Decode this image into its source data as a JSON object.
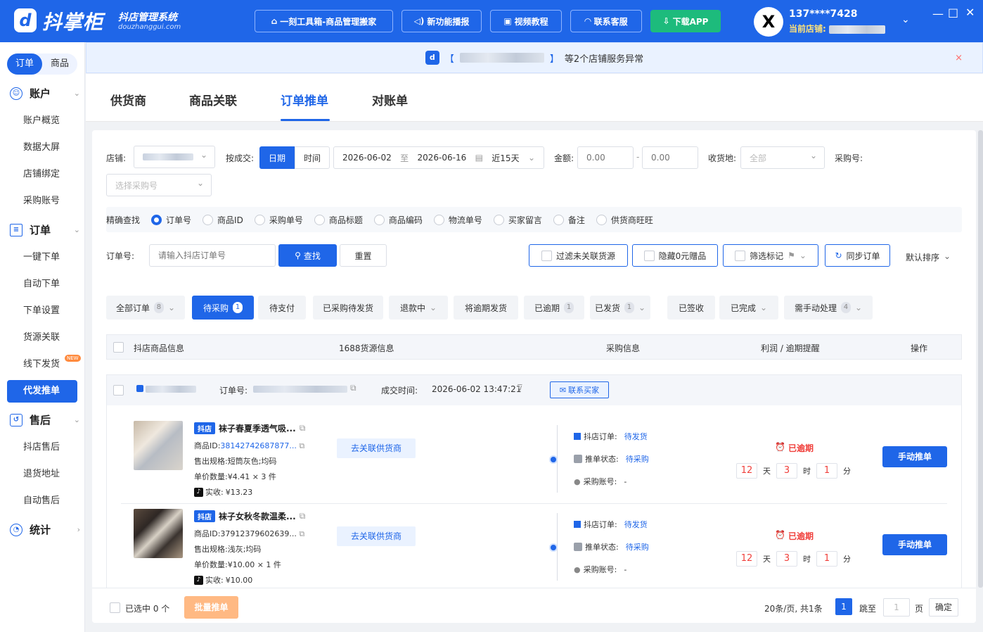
{
  "header": {
    "logo_text": "抖掌柜",
    "logo_subtitle": "抖店管理系统",
    "logo_domain": "douzhanggui.com",
    "buttons": [
      {
        "label": "一刻工具箱-商品管理搬家",
        "icon": "toolbox-icon"
      },
      {
        "label": "新功能播报",
        "icon": "speaker-icon"
      },
      {
        "label": "视频教程",
        "icon": "video-icon"
      },
      {
        "label": "联系客服",
        "icon": "headset-icon"
      },
      {
        "label": "下载APP",
        "icon": "download-icon"
      }
    ],
    "avatar_letter": "X",
    "user_phone": "137****7428",
    "current_store_label": "当前店铺:"
  },
  "sidebar": {
    "segments": [
      "订单",
      "商品"
    ],
    "groups": [
      {
        "label": "账户",
        "items": [
          "账户概览",
          "数据大屏",
          "店铺绑定",
          "采购账号"
        ]
      },
      {
        "label": "订单",
        "items": [
          "一键下单",
          "自动下单",
          "下单设置",
          "货源关联",
          "线下发货",
          "代发推单"
        ]
      },
      {
        "label": "售后",
        "items": [
          "抖店售后",
          "退货地址",
          "自动售后"
        ]
      },
      {
        "label": "统计",
        "items": []
      }
    ],
    "new_badge": "NEW"
  },
  "notice": {
    "open_bracket": "【",
    "close_bracket": "】",
    "text": "等2个店铺服务异常",
    "close": "×"
  },
  "tabs": [
    "供货商",
    "商品关联",
    "订单推单",
    "对账单"
  ],
  "filters": {
    "store_label": "店铺:",
    "deal_label": "按成交:",
    "date_btn": "日期",
    "time_btn": "时间",
    "date_start": "2026-06-02",
    "date_to": "至",
    "date_end": "2026-06-16",
    "date_range": "近15天",
    "amount_label": "金额:",
    "amount_min_placeholder": "0.00",
    "amount_sep": "-",
    "amount_max_placeholder": "0.00",
    "ship_label": "收货地:",
    "ship_value": "全部",
    "purchase_no_label": "采购号:",
    "purchase_no_placeholder": "选择采购号",
    "exact_label": "精确查找",
    "exact_options": [
      "订单号",
      "商品ID",
      "采购单号",
      "商品标题",
      "商品编码",
      "物流单号",
      "买家留言",
      "备注",
      "供货商旺旺"
    ],
    "order_no_label": "订单号:",
    "order_no_placeholder": "请输入抖店订单号",
    "search_btn": "查找",
    "reset_btn": "重置",
    "filter_unlinked": "过滤未关联货源",
    "hide_gift": "隐藏0元赠品",
    "filter_mark": "筛选标记",
    "sync_btn": "同步订单",
    "sort": "默认排序"
  },
  "status_tabs": [
    {
      "label": "全部订单",
      "count": "8",
      "chev": true
    },
    {
      "label": "待采购",
      "count": "1",
      "chev": false
    },
    {
      "label": "待支付",
      "count": "",
      "chev": false
    },
    {
      "label": "已采购待发货",
      "count": "",
      "chev": false
    },
    {
      "label": "退款中",
      "count": "",
      "chev": true
    },
    {
      "label": "将逾期发货",
      "count": "",
      "chev": false
    },
    {
      "label": "已逾期",
      "count": "1",
      "chev": false
    },
    {
      "label": "已发货",
      "count": "1",
      "chev": true
    },
    {
      "label": "已签收",
      "count": "",
      "chev": false
    },
    {
      "label": "已完成",
      "count": "",
      "chev": true
    },
    {
      "label": "需手动处理",
      "count": "4",
      "chev": true
    }
  ],
  "table_headers": [
    "抖店商品信息",
    "1688货源信息",
    "采购信息",
    "利润 / 逾期提醒",
    "操作"
  ],
  "order": {
    "order_no_label": "订单号:",
    "deal_time_label": "成交时间:",
    "deal_time": "2026-06-02 13:47:21",
    "contact_btn": "联系买家",
    "products": [
      {
        "badge": "抖店",
        "title": "袜子春夏季透气吸...",
        "id_label": "商品ID:",
        "id": "38142742687877...",
        "spec_label": "售出规格:",
        "spec": "短筒灰色;均码",
        "qty_label": "单价数量:",
        "qty": "¥4.41 × 3 件",
        "paid_label": "实收:",
        "paid": "¥13.23",
        "link_btn": "去关联供货商",
        "dy_order_label": "抖店订单:",
        "dy_order_status": "待发货",
        "push_label": "推单状态:",
        "push_status": "待采购",
        "buyer_acc_label": "采购账号:",
        "buyer_acc": "-",
        "overdue": "已逾期",
        "days": "12",
        "day_unit": "天",
        "hours": "3",
        "hour_unit": "时",
        "mins": "1",
        "min_unit": "分",
        "action": "手动推单"
      },
      {
        "badge": "抖店",
        "title": "袜子女秋冬款温柔...",
        "id_label": "商品ID:",
        "id": "37912379602639...",
        "spec_label": "售出规格:",
        "spec": "浅灰;均码",
        "qty_label": "单价数量:",
        "qty": "¥10.00 × 1 件",
        "paid_label": "实收:",
        "paid": "¥10.00",
        "link_btn": "去关联供货商",
        "dy_order_label": "抖店订单:",
        "dy_order_status": "待发货",
        "push_label": "推单状态:",
        "push_status": "待采购",
        "buyer_acc_label": "采购账号:",
        "buyer_acc": "-",
        "overdue": "已逾期",
        "days": "12",
        "day_unit": "天",
        "hours": "3",
        "hour_unit": "时",
        "mins": "1",
        "min_unit": "分",
        "action": "手动推单"
      }
    ]
  },
  "footer": {
    "selected": "已选中 0 个",
    "batch_btn": "批量推单",
    "per_page": "20条/页, 共1条",
    "page": "1",
    "goto": "跳至",
    "page_unit": "页",
    "confirm": "确定",
    "page_input": "1"
  },
  "colors": {
    "brand": "#1f66e8",
    "danger": "#f0403c",
    "green": "#1dbb7c",
    "orange": "#ffb983"
  }
}
